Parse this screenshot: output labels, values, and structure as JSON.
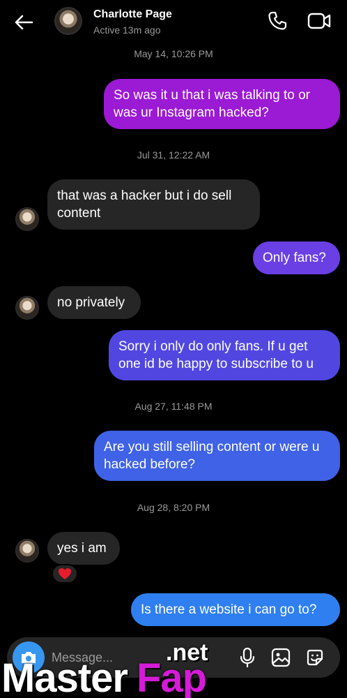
{
  "header": {
    "name": "Charlotte Page",
    "status": "Active 13m ago",
    "back_icon": "arrow-left-icon",
    "call_icon": "phone-icon",
    "video_icon": "video-camera-icon"
  },
  "colors": {
    "outgoing_purple": "#9b1ad4",
    "outgoing_violet": "#6a3fe3",
    "outgoing_indigo": "#5147e0",
    "outgoing_blue": "#3f62e6",
    "outgoing_sky": "#2f7ff0",
    "incoming": "#262626",
    "watermark_accent": "#d51bd8"
  },
  "timestamps": [
    "May 14, 10:26 PM",
    "Jul 31, 12:22 AM",
    "Aug 27, 11:48 PM",
    "Aug 28, 8:20 PM"
  ],
  "messages": [
    {
      "direction": "outgoing",
      "text": "So was it u that i was talking to or was ur Instagram hacked?"
    },
    {
      "direction": "incoming",
      "text": "that was a hacker but i do sell content"
    },
    {
      "direction": "outgoing",
      "text": "Only fans?"
    },
    {
      "direction": "incoming",
      "text": "no privately"
    },
    {
      "direction": "outgoing",
      "text": "Sorry i only do only fans. If u get one id be happy to subscribe to u"
    },
    {
      "direction": "outgoing",
      "text": "Are you still selling content or were u hacked before?"
    },
    {
      "direction": "incoming",
      "text": "yes i am",
      "reaction": "❤️"
    },
    {
      "direction": "outgoing",
      "text": "Is there a website i can go to?"
    }
  ],
  "composer": {
    "placeholder": "Message...",
    "camera_icon": "camera-icon",
    "mic_icon": "microphone-icon",
    "gallery_icon": "image-icon",
    "sticker_icon": "sticker-icon"
  },
  "watermark": {
    "part1": "Master",
    "part2": "Fap",
    "part3": ".net"
  }
}
